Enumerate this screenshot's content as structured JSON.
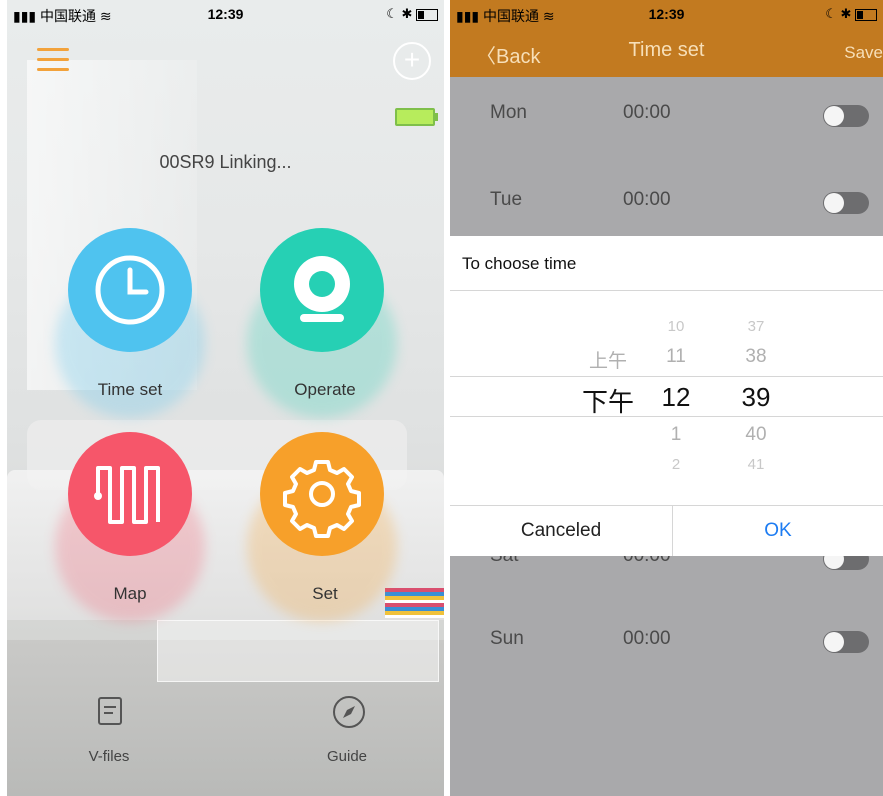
{
  "left_screen": {
    "status": {
      "carrier": "中国联通",
      "time": "12:39"
    },
    "device_status": "00SR9 Linking...",
    "tiles": [
      {
        "label": "Time set",
        "icon": "clock-icon",
        "color": "#4fc3ef"
      },
      {
        "label": "Operate",
        "icon": "camera-icon",
        "color": "#26d0b4"
      },
      {
        "label": "Map",
        "icon": "map-path-icon",
        "color": "#f6566a"
      },
      {
        "label": "Set",
        "icon": "gear-icon",
        "color": "#f7a02a"
      }
    ],
    "bottom_nav": [
      {
        "label": "V-files",
        "icon": "document-icon"
      },
      {
        "label": "Guide",
        "icon": "compass-icon"
      }
    ]
  },
  "right_screen": {
    "status": {
      "carrier": "中国联通",
      "time": "12:39"
    },
    "back_label": "Back",
    "title": "Time set",
    "save_label": "Save",
    "schedule": [
      {
        "day": "Mon",
        "time": "00:00"
      },
      {
        "day": "Tue",
        "time": "00:00"
      },
      {
        "day": "Sat",
        "time": "00:00"
      },
      {
        "day": "Sun",
        "time": "00:00"
      }
    ],
    "dialog": {
      "title": "To choose time",
      "ampm": {
        "above": "上午",
        "selected": "下午"
      },
      "hours": {
        "above2": "10",
        "above1": "11",
        "selected": "12",
        "below1": "1",
        "below2": "2"
      },
      "minutes": {
        "above2": "37",
        "above1": "38",
        "selected": "39",
        "below1": "40",
        "below2": "41"
      },
      "cancel_label": "Canceled",
      "ok_label": "OK"
    },
    "accent": "#c27a20"
  }
}
